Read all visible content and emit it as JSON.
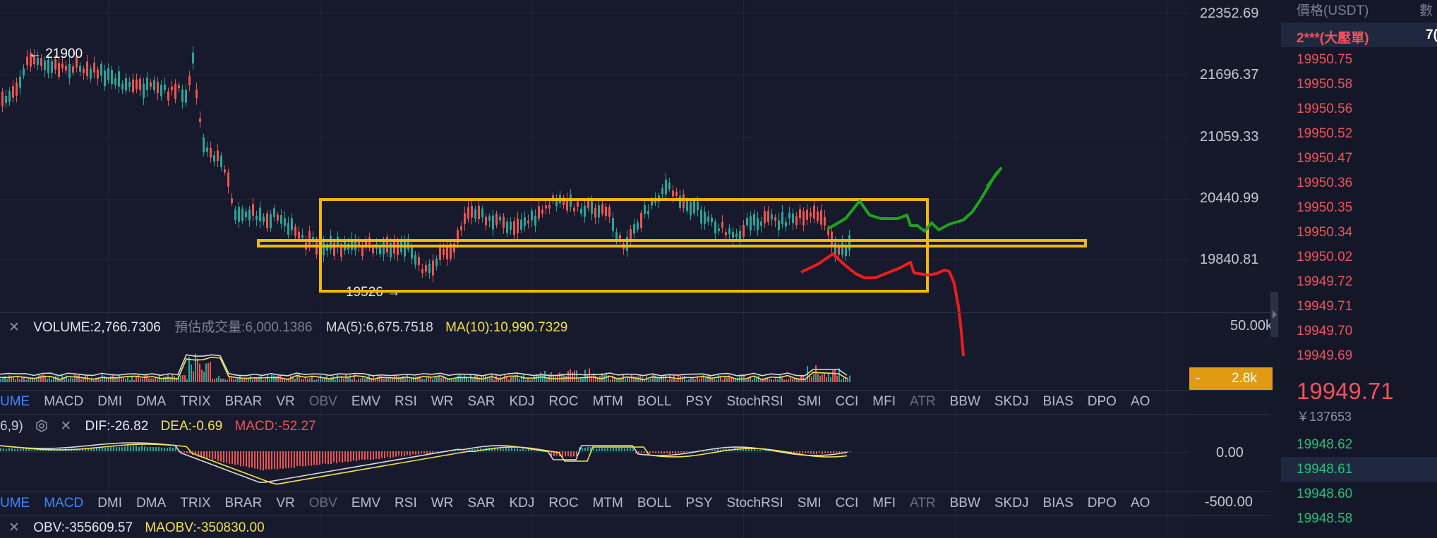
{
  "price_axis": {
    "labels": [
      "22352.69",
      "21696.37",
      "21059.33",
      "20440.99",
      "19840.81"
    ],
    "volume_max": "50.00k",
    "volume_tag": "2.8k",
    "macd_labels": [
      "0.00",
      "-500.00"
    ]
  },
  "annotations": {
    "high_label": "← 21900",
    "low_label": "19526 →"
  },
  "volume_legend": {
    "close": "✕",
    "volume": "VOLUME:2,766.7306",
    "estimated": "預估成交量:6,000.1386",
    "ma5": "MA(5):6,675.7518",
    "ma10": "MA(10):10,990.7329"
  },
  "indicator_tabs": [
    "UME",
    "MACD",
    "DMI",
    "DMA",
    "TRIX",
    "BRAR",
    "VR",
    "OBV",
    "EMV",
    "RSI",
    "WR",
    "SAR",
    "KDJ",
    "ROC",
    "MTM",
    "BOLL",
    "PSY",
    "StochRSI",
    "SMI",
    "CCI",
    "MFI",
    "ATR",
    "BBW",
    "SKDJ",
    "BIAS",
    "DPO",
    "AO"
  ],
  "macd_legend": {
    "params": "6,9)",
    "close": "✕",
    "dif": "DIF:-26.82",
    "dea": "DEA:-0.69",
    "macd": "MACD:-52.27"
  },
  "obv_legend": {
    "close": "✕",
    "obv": "OBV:-355609.57",
    "maobv": "MAOBV:-350830.00"
  },
  "orderbook": {
    "header_price": "價格(USDT)",
    "header_qty": "數",
    "big_order": "2***(大壓單)",
    "big_order_qty": "7(",
    "asks": [
      "19950.75",
      "19950.58",
      "19950.56",
      "19950.52",
      "19950.47",
      "19950.36",
      "19950.35",
      "19950.34",
      "19950.02",
      "19949.72",
      "19949.71",
      "19949.70",
      "19949.69"
    ],
    "last_price": "19949.71",
    "last_price_cny": "￥137653",
    "bids": [
      "19948.62",
      "19948.61",
      "19948.60",
      "19948.58"
    ]
  },
  "colors": {
    "up": "#26a69a",
    "down": "#ef5350",
    "box": "#f5b700",
    "green_path": "#1ea31e",
    "red_path": "#ee1c1c"
  }
}
